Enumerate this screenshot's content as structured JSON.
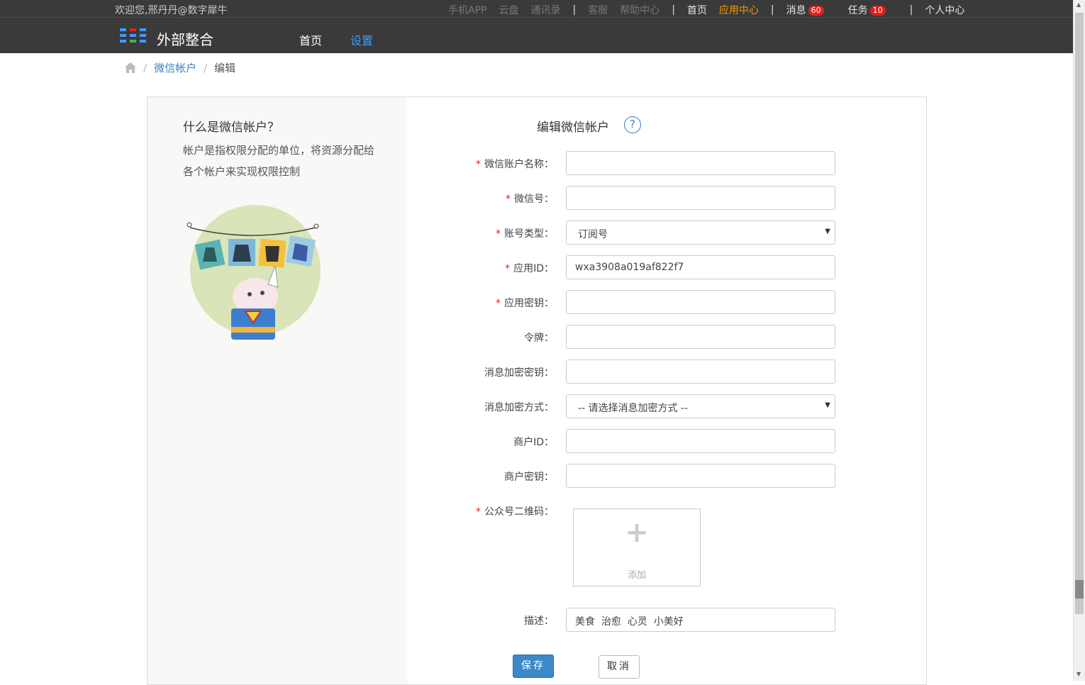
{
  "header": {
    "welcome": "欢迎您,邢丹丹@数字犀牛",
    "links": {
      "mobile_app": "手机APP",
      "cloud_disk": "云盘",
      "contacts": "通讯录",
      "service": "客服",
      "help_center": "帮助中心",
      "home": "首页",
      "app_center": "应用中心",
      "messages": "消息",
      "messages_count": "60",
      "tasks": "任务",
      "tasks_count": "10",
      "personal_center": "个人中心",
      "separator": "|"
    },
    "logo_text": "外部整合",
    "nav": {
      "home": "首页",
      "settings": "设置"
    }
  },
  "breadcrumb": {
    "home_icon": "home-icon",
    "sep": "/",
    "link": "微信帐户",
    "current": "编辑"
  },
  "left_panel": {
    "title": "什么是微信帐户？",
    "description": "帐户是指权限分配的单位，将资源分配给各个帐户来实现权限控制"
  },
  "form": {
    "title": "编辑微信帐户",
    "help_icon": "?",
    "required_mark": "*",
    "fields": [
      {
        "label": "微信账户名称：",
        "value": "",
        "required": true
      },
      {
        "label": "微信号：",
        "value": "",
        "required": true
      },
      {
        "label": "账号类型：",
        "value": "订阅号",
        "required": true,
        "type": "select"
      },
      {
        "label": "应用ID：",
        "value": "wxa3908a019af822f7",
        "required": true
      },
      {
        "label": "应用密钥：",
        "value": "",
        "required": true
      },
      {
        "label": "令牌：",
        "value": "",
        "required": false
      },
      {
        "label": "消息加密密钥：",
        "value": "",
        "required": false
      },
      {
        "label": "消息加密方式：",
        "value": "-- 请选择消息加密方式 --",
        "required": false,
        "type": "select"
      },
      {
        "label": "商户ID：",
        "value": "",
        "required": false
      },
      {
        "label": "商户密钥：",
        "value": "",
        "required": false
      }
    ],
    "qrcode": {
      "label": "公众号二维码：",
      "required": true,
      "plus": "+",
      "add": "添加"
    },
    "description": {
      "label": "描述：",
      "value": "美食  治愈  心灵  小美好"
    },
    "save": "保存",
    "cancel": "取消"
  },
  "colors": {
    "topbar": "#3a3a3a",
    "accent_blue": "#3e9bff",
    "orange": "#f39800",
    "badge_red": "#e02020",
    "save_button": "#3d88c8"
  }
}
